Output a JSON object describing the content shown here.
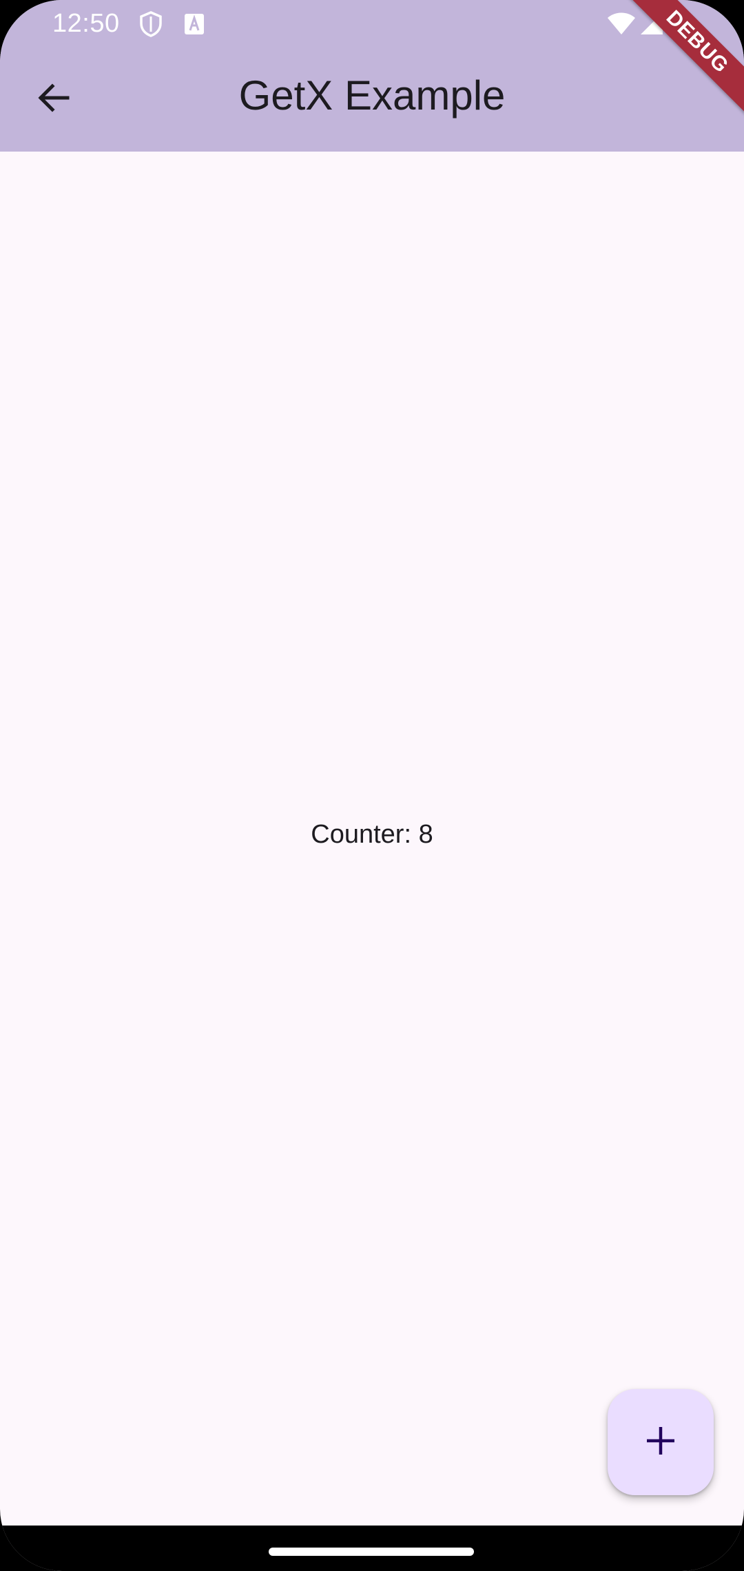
{
  "status_bar": {
    "time": "12:50",
    "icons": [
      "shield-icon",
      "font-a-icon",
      "wifi-icon",
      "signal-icon",
      "battery-icon"
    ]
  },
  "debug_banner": {
    "label": "DEBUG"
  },
  "app_bar": {
    "title": "GetX Example",
    "back_icon": "arrow-back-icon"
  },
  "body": {
    "counter_text": "Counter: 8"
  },
  "fab": {
    "icon": "add-icon"
  },
  "colors": {
    "app_bar_bg": "#c2b5da",
    "page_bg": "#fdf7fc",
    "fab_bg": "#eaddff",
    "debug_banner": "#a62d3c",
    "text": "#1d1b20"
  }
}
